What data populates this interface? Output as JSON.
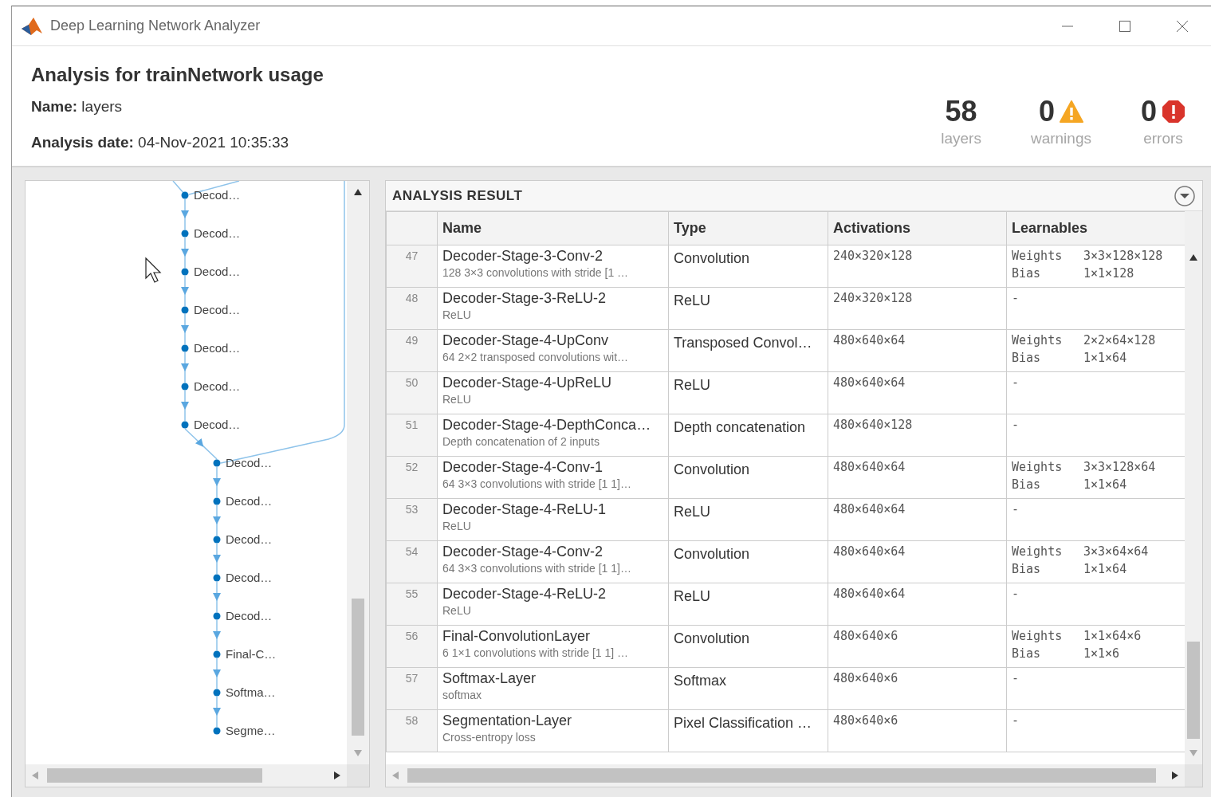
{
  "window": {
    "title": "Deep Learning Network Analyzer"
  },
  "header": {
    "title": "Analysis for trainNetwork usage",
    "name_label": "Name:",
    "name_value": "layers",
    "date_label": "Analysis date:",
    "date_value": "04-Nov-2021 10:35:33"
  },
  "stats": [
    {
      "kind": "plain",
      "value": "58",
      "label": "layers"
    },
    {
      "kind": "warning",
      "value": "0",
      "label": "warnings"
    },
    {
      "kind": "error",
      "value": "0",
      "label": "errors"
    }
  ],
  "graph": {
    "nodes": [
      {
        "label": "Decod…",
        "kind": "branch"
      },
      {
        "label": "Decod…",
        "kind": "branch"
      },
      {
        "label": "Decod…",
        "kind": "branch"
      },
      {
        "label": "Decod…",
        "kind": "branch"
      },
      {
        "label": "Decod…",
        "kind": "branch"
      },
      {
        "label": "Decod…",
        "kind": "branch"
      },
      {
        "label": "Decod…",
        "kind": "branch"
      },
      {
        "label": "Decod…",
        "kind": "main"
      },
      {
        "label": "Decod…",
        "kind": "main"
      },
      {
        "label": "Decod…",
        "kind": "main"
      },
      {
        "label": "Decod…",
        "kind": "main"
      },
      {
        "label": "Decod…",
        "kind": "main"
      },
      {
        "label": "Final-C…",
        "kind": "main"
      },
      {
        "label": "Softma…",
        "kind": "main"
      },
      {
        "label": "Segme…",
        "kind": "main"
      }
    ]
  },
  "result": {
    "title": "ANALYSIS RESULT",
    "columns": [
      "Name",
      "Type",
      "Activations",
      "Learnables"
    ],
    "rows": [
      {
        "index": "47",
        "name": "Decoder-Stage-3-Conv-2",
        "description": "128 3×3 convolutions with stride [1 …",
        "type": "Convolution",
        "activations": "240×320×128",
        "learnables": [
          {
            "label": "Weights",
            "value": "3×3×128×128"
          },
          {
            "label": "Bias",
            "value": "1×1×128"
          }
        ]
      },
      {
        "index": "48",
        "name": "Decoder-Stage-3-ReLU-2",
        "description": "ReLU",
        "type": "ReLU",
        "activations": "240×320×128",
        "learnables": "-"
      },
      {
        "index": "49",
        "name": "Decoder-Stage-4-UpConv",
        "description": "64 2×2 transposed convolutions wit…",
        "type": "Transposed Convol…",
        "activations": "480×640×64",
        "learnables": [
          {
            "label": "Weights",
            "value": "2×2×64×128"
          },
          {
            "label": "Bias",
            "value": "1×1×64"
          }
        ]
      },
      {
        "index": "50",
        "name": "Decoder-Stage-4-UpReLU",
        "description": "ReLU",
        "type": "ReLU",
        "activations": "480×640×64",
        "learnables": "-"
      },
      {
        "index": "51",
        "name": "Decoder-Stage-4-DepthConca…",
        "description": "Depth concatenation of 2 inputs",
        "type": "Depth concatenation",
        "activations": "480×640×128",
        "learnables": "-"
      },
      {
        "index": "52",
        "name": "Decoder-Stage-4-Conv-1",
        "description": "64 3×3 convolutions with stride [1 1]…",
        "type": "Convolution",
        "activations": "480×640×64",
        "learnables": [
          {
            "label": "Weights",
            "value": "3×3×128×64"
          },
          {
            "label": "Bias",
            "value": "1×1×64"
          }
        ]
      },
      {
        "index": "53",
        "name": "Decoder-Stage-4-ReLU-1",
        "description": "ReLU",
        "type": "ReLU",
        "activations": "480×640×64",
        "learnables": "-"
      },
      {
        "index": "54",
        "name": "Decoder-Stage-4-Conv-2",
        "description": "64 3×3 convolutions with stride [1 1]…",
        "type": "Convolution",
        "activations": "480×640×64",
        "learnables": [
          {
            "label": "Weights",
            "value": "3×3×64×64"
          },
          {
            "label": "Bias",
            "value": "1×1×64"
          }
        ]
      },
      {
        "index": "55",
        "name": "Decoder-Stage-4-ReLU-2",
        "description": "ReLU",
        "type": "ReLU",
        "activations": "480×640×64",
        "learnables": "-"
      },
      {
        "index": "56",
        "name": "Final-ConvolutionLayer",
        "description": "6 1×1 convolutions with stride [1 1] …",
        "type": "Convolution",
        "activations": "480×640×6",
        "learnables": [
          {
            "label": "Weights",
            "value": "1×1×64×6"
          },
          {
            "label": "Bias",
            "value": "1×1×6"
          }
        ]
      },
      {
        "index": "57",
        "name": "Softmax-Layer",
        "description": "softmax",
        "type": "Softmax",
        "activations": "480×640×6",
        "learnables": "-"
      },
      {
        "index": "58",
        "name": "Segmentation-Layer",
        "description": "Cross-entropy loss",
        "type": "Pixel Classification …",
        "activations": "480×640×6",
        "learnables": "-"
      }
    ]
  }
}
